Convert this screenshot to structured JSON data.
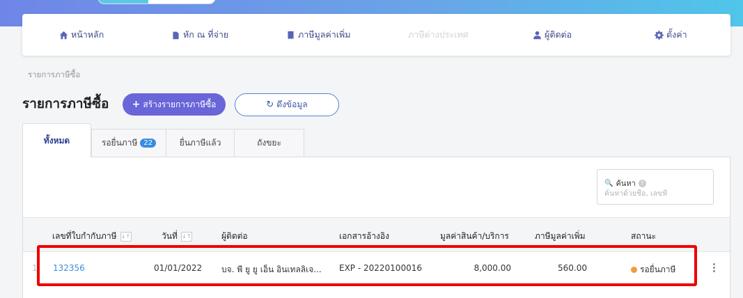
{
  "nav": {
    "items": [
      {
        "label": "หน้าหลัก",
        "icon": "home-icon"
      },
      {
        "label": "หัก ณ ที่จ่าย",
        "icon": "document-icon"
      },
      {
        "label": "ภาษีมูลค่าเพิ่ม",
        "icon": "receipt-icon"
      },
      {
        "label": "ภาษีต่างประเทศ",
        "icon": "none",
        "disabled": true
      },
      {
        "label": "ผู้ติดต่อ",
        "icon": "user-icon"
      },
      {
        "label": "ตั้งค่า",
        "icon": "gear-icon"
      }
    ]
  },
  "breadcrumb": "รายการภาษีซื้อ",
  "page_title": "รายการภาษีซื้อ",
  "actions": {
    "create_label": "สร้างรายการภาษีซื้อ",
    "fetch_label": "ดึงข้อมูล"
  },
  "tabs": [
    {
      "label": "ทั้งหมด",
      "active": true
    },
    {
      "label": "รอยื่นภาษี",
      "badge": "22"
    },
    {
      "label": "ยื่นภาษีแล้ว"
    },
    {
      "label": "ถังขยะ"
    }
  ],
  "search": {
    "label": "ค้นหา",
    "placeholder": "ค้นหาด้วยชื่อ, เลขที่"
  },
  "table": {
    "columns": [
      "เลขที่ใบกำกับภาษี",
      "วันที่",
      "ผู้ติดต่อ",
      "เอกสารอ้างอิง",
      "มูลค่าสินค้า/บริการ",
      "ภาษีมูลค่าเพิ่ม",
      "สถานะ"
    ],
    "rows": [
      {
        "row_number": "1",
        "invoice_no": "132356",
        "date": "01/01/2022",
        "contact": "บจ. พี ยู ยู เอ็น อินเทลลิเจ...",
        "reference": "EXP - 20220100016",
        "amount": "8,000.00",
        "vat": "560.00",
        "status": "รอยื่นภาษี"
      }
    ]
  },
  "colors": {
    "accent": "#6a65d8",
    "link": "#3a8de0",
    "status_pending": "#f39c3a",
    "highlight": "#ee0000"
  }
}
